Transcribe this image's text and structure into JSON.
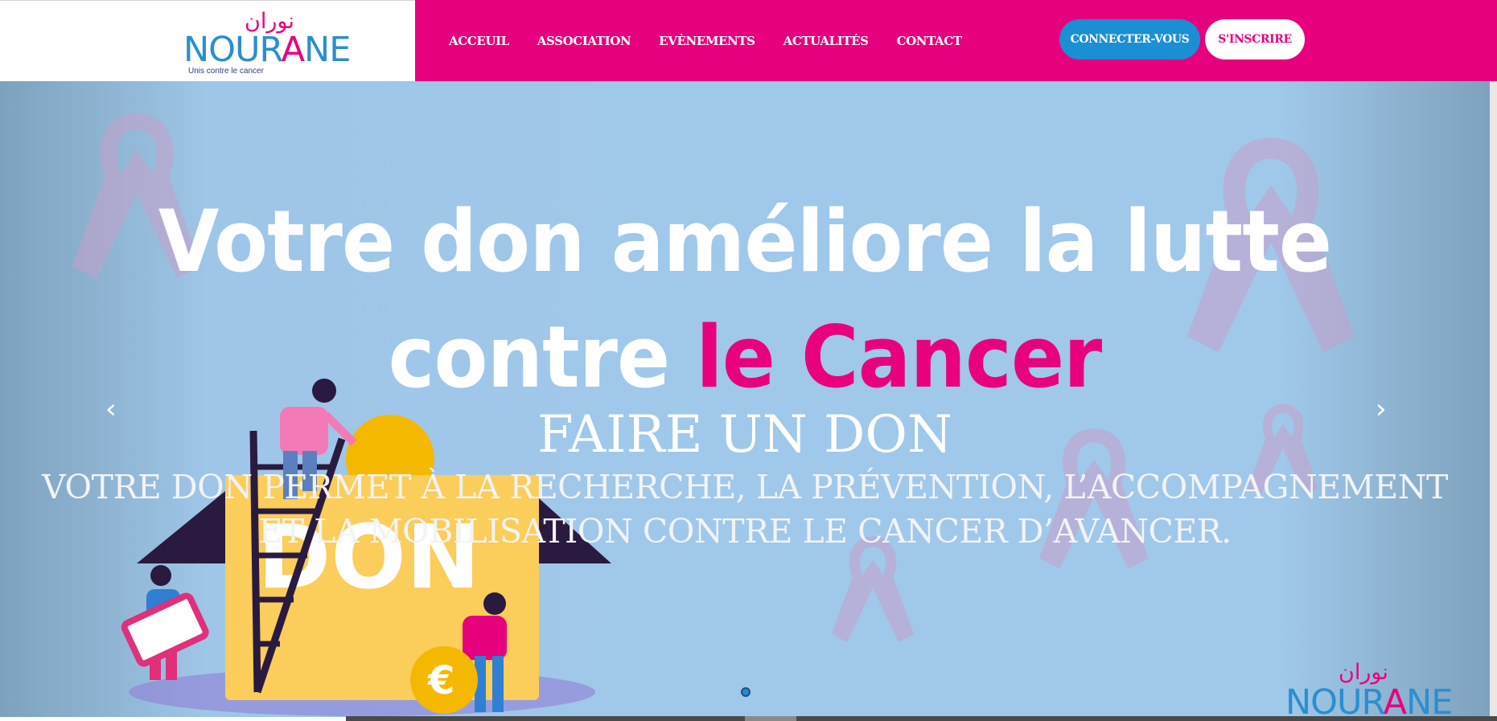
{
  "brand": {
    "arabic_name": "نوران",
    "name_part1": "NOUR",
    "name_mid": "A",
    "name_part2": "NE",
    "tagline": "Unis contre le cancer"
  },
  "nav": {
    "items": [
      {
        "label": "ACCEUIL"
      },
      {
        "label": "ASSOCIATION"
      },
      {
        "label": "EVÈNEMENTS"
      },
      {
        "label": "ACTUALITÉS"
      },
      {
        "label": "CONTACT"
      }
    ],
    "login_label": "CONNECTER-VOUS",
    "signup_label": "S'INSCRIRE"
  },
  "hero": {
    "headline_line1": "Votre don améliore la lutte",
    "headline_line2_white": "contre ",
    "headline_line2_pink": "le Cancer",
    "illustration_text": "DON",
    "cta_title": "FAIRE UN DON",
    "cta_text": "VOTRE DON PERMET À LA RECHERCHE, LA PRÉVENTION, L’ACCOMPAGNEMENT ET LA MOBILISATION CONTRE LE CANCER D’AVANCER.",
    "prev_icon": "chevron-left-icon",
    "next_icon": "chevron-right-icon",
    "slides_count": 1,
    "active_slide": 1
  },
  "colors": {
    "brand_pink": "#e6007e",
    "brand_blue": "#1a8fd3",
    "hero_bg": "#a0c8ea"
  }
}
